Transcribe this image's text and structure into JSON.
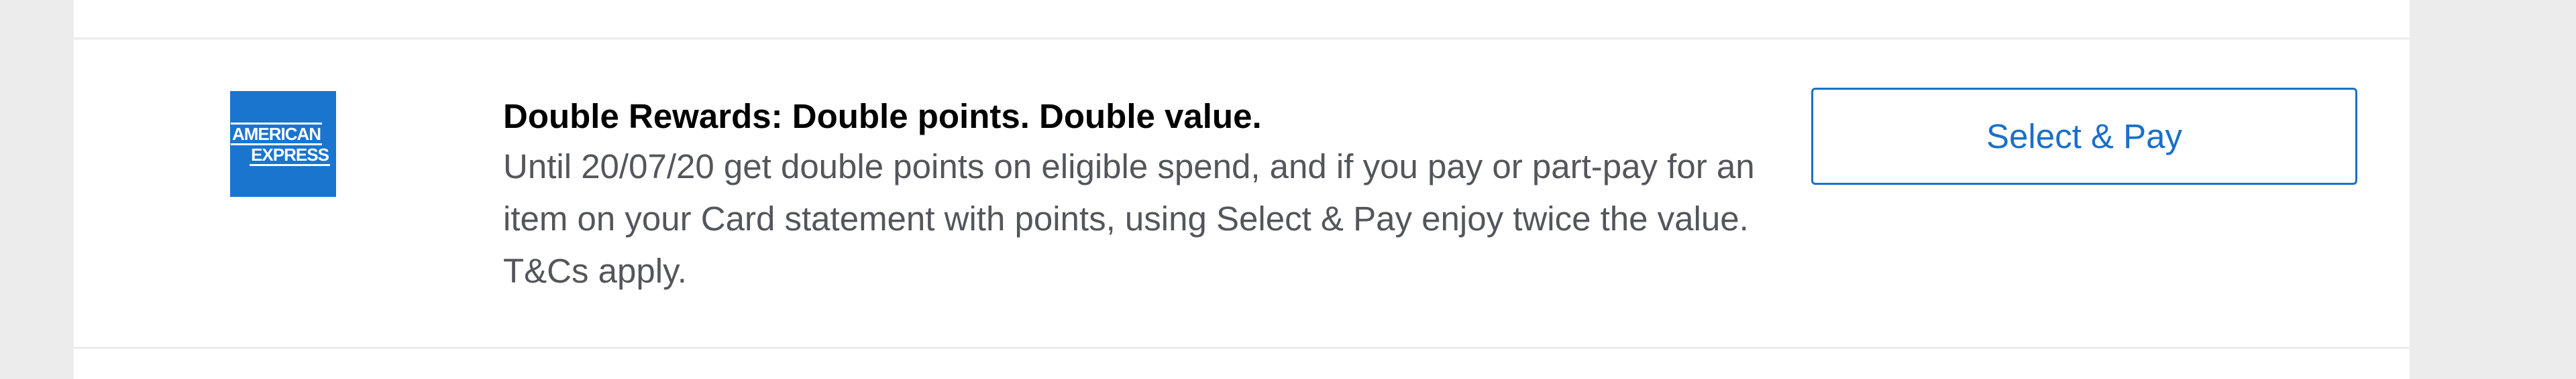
{
  "logo": {
    "line1": "AMERICAN",
    "line2": "EXPRESS",
    "color": "#1a75cf"
  },
  "offer": {
    "title": "Double Rewards: Double points. Double value.",
    "body": "Until 20/07/20 get double points on eligible spend, and if you pay or part-pay for an item on your Card statement with points, using Select & Pay enjoy twice the value. T&Cs apply."
  },
  "cta": {
    "label": "Select & Pay",
    "color": "#1a6fc9"
  }
}
